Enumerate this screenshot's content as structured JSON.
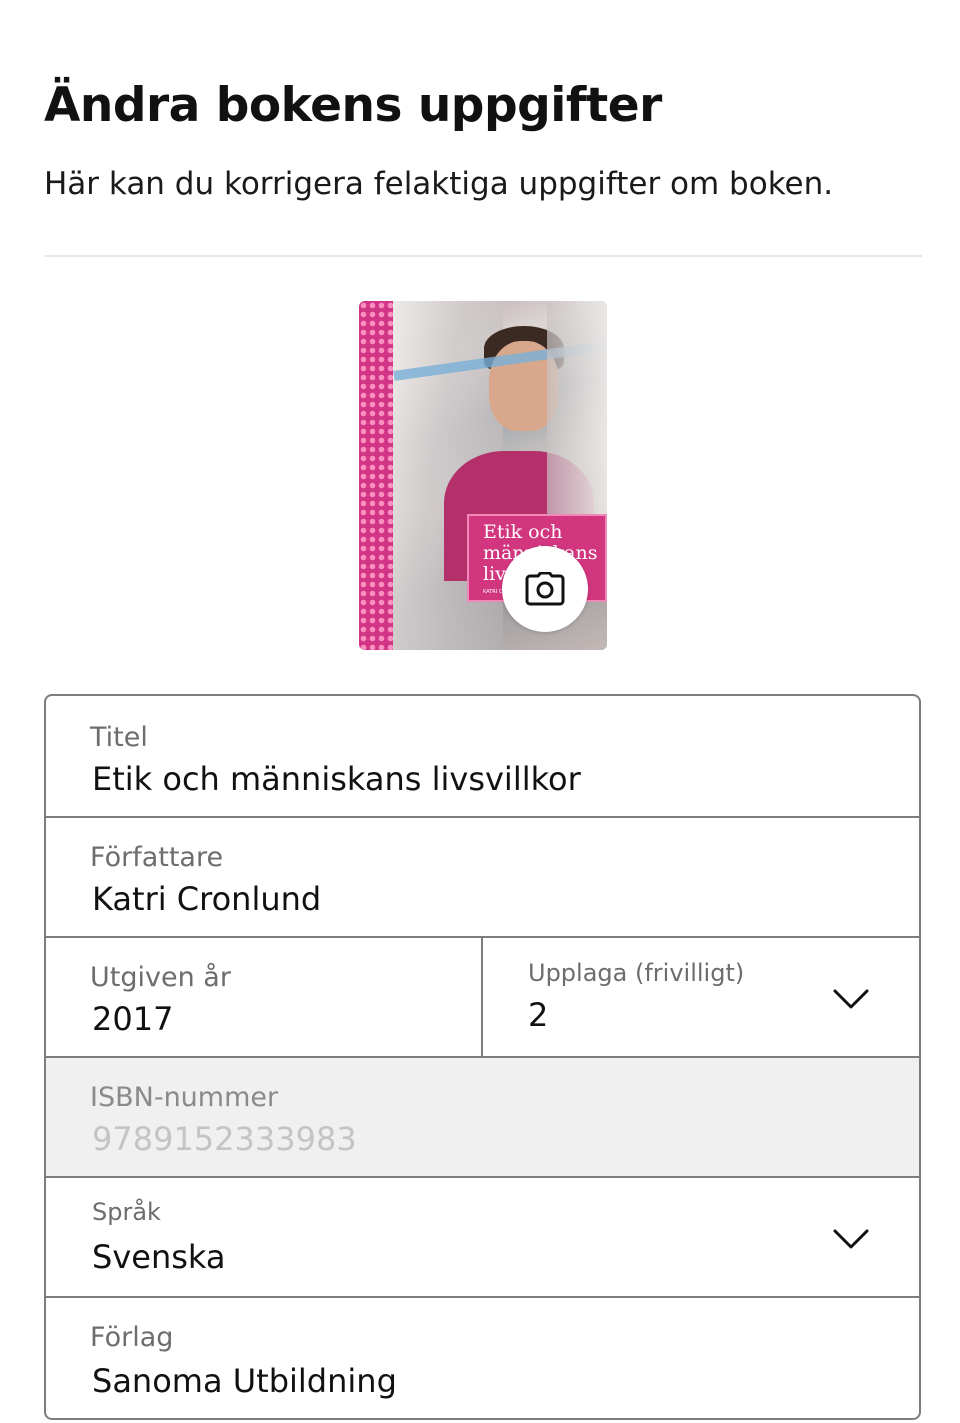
{
  "header": {
    "title": "Ändra bokens uppgifter",
    "subtitle": "Här kan du korrigera felaktiga uppgifter om boken."
  },
  "cover": {
    "title": "Etik och människans livsvillkor",
    "author": "KATRI CRONLUND",
    "spine_color": "#d23585",
    "camera_icon": "camera-icon"
  },
  "form": {
    "title": {
      "label": "Titel",
      "value": "Etik och människans livsvillkor"
    },
    "author": {
      "label": "Författare",
      "value": "Katri Cronlund"
    },
    "year": {
      "label": "Utgiven år",
      "value": "2017"
    },
    "edition": {
      "label": "Upplaga (frivilligt)",
      "value": "2",
      "icon": "chevron-down-icon"
    },
    "isbn": {
      "label": "ISBN-nummer",
      "value": "9789152333983",
      "disabled": true
    },
    "language": {
      "label": "Språk",
      "value": "Svenska",
      "icon": "chevron-down-icon"
    },
    "publisher": {
      "label": "Förlag",
      "value": "Sanoma Utbildning"
    }
  }
}
